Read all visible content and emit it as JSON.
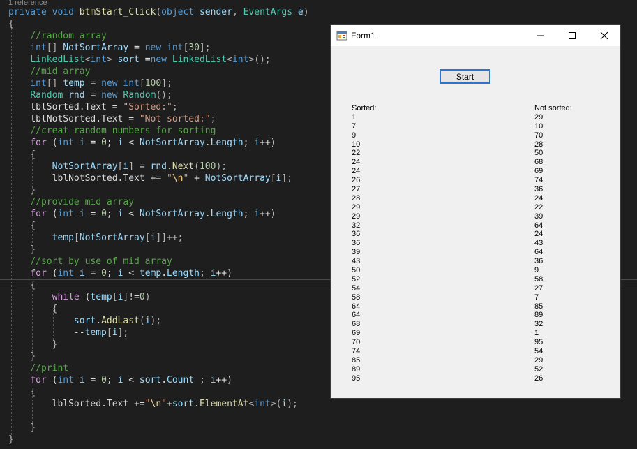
{
  "editor": {
    "codelens": "1 reference",
    "lines": [
      [
        [
          "kw",
          "private"
        ],
        [
          "t",
          " "
        ],
        [
          "kw",
          "void"
        ],
        [
          "t",
          " "
        ],
        [
          "fn",
          "btmStart_Click"
        ],
        [
          "pun",
          "("
        ],
        [
          "kw",
          "object"
        ],
        [
          "t",
          " "
        ],
        [
          "var",
          "sender"
        ],
        [
          "pun",
          ", "
        ],
        [
          "ty",
          "EventArgs"
        ],
        [
          "t",
          " "
        ],
        [
          "var",
          "e"
        ],
        [
          "pun",
          ")"
        ]
      ],
      [
        [
          "pun",
          "{"
        ]
      ],
      [
        [
          "t",
          "    "
        ],
        [
          "com",
          "//random array"
        ]
      ],
      [
        [
          "t",
          "    "
        ],
        [
          "kw",
          "int"
        ],
        [
          "pun",
          "[] "
        ],
        [
          "var",
          "NotSortArray"
        ],
        [
          "t",
          " = "
        ],
        [
          "kw",
          "new"
        ],
        [
          "t",
          " "
        ],
        [
          "kw",
          "int"
        ],
        [
          "pun",
          "["
        ],
        [
          "num",
          "30"
        ],
        [
          "pun",
          "];"
        ]
      ],
      [
        [
          "t",
          "    "
        ],
        [
          "ty",
          "LinkedList"
        ],
        [
          "pun",
          "<"
        ],
        [
          "kw",
          "int"
        ],
        [
          "pun",
          "> "
        ],
        [
          "var",
          "sort"
        ],
        [
          "t",
          " ="
        ],
        [
          "kw",
          "new"
        ],
        [
          "t",
          " "
        ],
        [
          "ty",
          "LinkedList"
        ],
        [
          "pun",
          "<"
        ],
        [
          "kw",
          "int"
        ],
        [
          "pun",
          ">();"
        ]
      ],
      [
        [
          "t",
          "    "
        ],
        [
          "com",
          "//mid array"
        ]
      ],
      [
        [
          "t",
          "    "
        ],
        [
          "kw",
          "int"
        ],
        [
          "pun",
          "[] "
        ],
        [
          "var",
          "temp"
        ],
        [
          "t",
          " = "
        ],
        [
          "kw",
          "new"
        ],
        [
          "t",
          " "
        ],
        [
          "kw",
          "int"
        ],
        [
          "pun",
          "["
        ],
        [
          "num",
          "100"
        ],
        [
          "pun",
          "];"
        ]
      ],
      [
        [
          "t",
          "    "
        ],
        [
          "ty",
          "Random"
        ],
        [
          "t",
          " "
        ],
        [
          "var",
          "rnd"
        ],
        [
          "t",
          " = "
        ],
        [
          "kw",
          "new"
        ],
        [
          "t",
          " "
        ],
        [
          "ty",
          "Random"
        ],
        [
          "pun",
          "();"
        ]
      ],
      [
        [
          "t",
          "    "
        ],
        [
          "t",
          "lblSorted.Text = "
        ],
        [
          "str",
          "\"Sorted:\""
        ],
        [
          "pun",
          ";"
        ]
      ],
      [
        [
          "t",
          "    "
        ],
        [
          "t",
          "lblNotSorted.Text = "
        ],
        [
          "str",
          "\"Not sorted:\""
        ],
        [
          "pun",
          ";"
        ]
      ],
      [
        [
          "t",
          "    "
        ],
        [
          "com",
          "//creat random numbers for sorting"
        ]
      ],
      [
        [
          "t",
          "    "
        ],
        [
          "ctl",
          "for"
        ],
        [
          "t",
          " ("
        ],
        [
          "kw",
          "int"
        ],
        [
          "t",
          " "
        ],
        [
          "var",
          "i"
        ],
        [
          "t",
          " = "
        ],
        [
          "num",
          "0"
        ],
        [
          "t",
          "; "
        ],
        [
          "var",
          "i"
        ],
        [
          "t",
          " < "
        ],
        [
          "var",
          "NotSortArray"
        ],
        [
          "t",
          "."
        ],
        [
          "var",
          "Length"
        ],
        [
          "t",
          "; "
        ],
        [
          "var",
          "i"
        ],
        [
          "t",
          "++)"
        ]
      ],
      [
        [
          "t",
          "    "
        ],
        [
          "pun",
          "{"
        ]
      ],
      [
        [
          "t",
          "        "
        ],
        [
          "var",
          "NotSortArray"
        ],
        [
          "pun",
          "["
        ],
        [
          "var",
          "i"
        ],
        [
          "pun",
          "]"
        ],
        [
          "t",
          " = "
        ],
        [
          "var",
          "rnd"
        ],
        [
          "t",
          "."
        ],
        [
          "fn",
          "Next"
        ],
        [
          "pun",
          "("
        ],
        [
          "num",
          "100"
        ],
        [
          "pun",
          ");"
        ]
      ],
      [
        [
          "t",
          "        "
        ],
        [
          "t",
          "lblNotSorted.Text += "
        ],
        [
          "str",
          "\""
        ],
        [
          "esc",
          "\\n"
        ],
        [
          "str",
          "\""
        ],
        [
          "t",
          " + "
        ],
        [
          "var",
          "NotSortArray"
        ],
        [
          "pun",
          "["
        ],
        [
          "var",
          "i"
        ],
        [
          "pun",
          "];"
        ]
      ],
      [
        [
          "t",
          "    "
        ],
        [
          "pun",
          "}"
        ]
      ],
      [
        [
          "t",
          "    "
        ],
        [
          "com",
          "//provide mid array"
        ]
      ],
      [
        [
          "t",
          "    "
        ],
        [
          "ctl",
          "for"
        ],
        [
          "t",
          " ("
        ],
        [
          "kw",
          "int"
        ],
        [
          "t",
          " "
        ],
        [
          "var",
          "i"
        ],
        [
          "t",
          " = "
        ],
        [
          "num",
          "0"
        ],
        [
          "t",
          "; "
        ],
        [
          "var",
          "i"
        ],
        [
          "t",
          " < "
        ],
        [
          "var",
          "NotSortArray"
        ],
        [
          "t",
          "."
        ],
        [
          "var",
          "Length"
        ],
        [
          "t",
          "; "
        ],
        [
          "var",
          "i"
        ],
        [
          "t",
          "++)"
        ]
      ],
      [
        [
          "t",
          "    "
        ],
        [
          "pun",
          "{"
        ]
      ],
      [
        [
          "t",
          "        "
        ],
        [
          "var",
          "temp"
        ],
        [
          "pun",
          "["
        ],
        [
          "var",
          "NotSortArray"
        ],
        [
          "pun",
          "["
        ],
        [
          "var",
          "i"
        ],
        [
          "pun",
          "]]++;"
        ]
      ],
      [
        [
          "t",
          "    "
        ],
        [
          "pun",
          "}"
        ]
      ],
      [
        [
          "t",
          "    "
        ],
        [
          "com",
          "//sort by use of mid array"
        ]
      ],
      [
        [
          "t",
          "    "
        ],
        [
          "ctl",
          "for"
        ],
        [
          "t",
          " ("
        ],
        [
          "kw",
          "int"
        ],
        [
          "t",
          " "
        ],
        [
          "var",
          "i"
        ],
        [
          "t",
          " = "
        ],
        [
          "num",
          "0"
        ],
        [
          "t",
          "; "
        ],
        [
          "var",
          "i"
        ],
        [
          "t",
          " < "
        ],
        [
          "var",
          "temp"
        ],
        [
          "t",
          "."
        ],
        [
          "var",
          "Length"
        ],
        [
          "t",
          "; "
        ],
        [
          "var",
          "i"
        ],
        [
          "t",
          "++)"
        ]
      ],
      [
        [
          "t",
          "    "
        ],
        [
          "pun",
          "{"
        ]
      ],
      [
        [
          "t",
          "        "
        ],
        [
          "ctl",
          "while"
        ],
        [
          "t",
          " ("
        ],
        [
          "var",
          "temp"
        ],
        [
          "pun",
          "["
        ],
        [
          "var",
          "i"
        ],
        [
          "pun",
          "]"
        ],
        [
          "t",
          "!="
        ],
        [
          "num",
          "0"
        ],
        [
          "pun",
          ")"
        ]
      ],
      [
        [
          "t",
          "        "
        ],
        [
          "pun",
          "{"
        ]
      ],
      [
        [
          "t",
          "            "
        ],
        [
          "var",
          "sort"
        ],
        [
          "t",
          "."
        ],
        [
          "fn",
          "AddLast"
        ],
        [
          "pun",
          "("
        ],
        [
          "var",
          "i"
        ],
        [
          "pun",
          ");"
        ]
      ],
      [
        [
          "t",
          "            "
        ],
        [
          "t",
          "--"
        ],
        [
          "var",
          "temp"
        ],
        [
          "pun",
          "["
        ],
        [
          "var",
          "i"
        ],
        [
          "pun",
          "];"
        ]
      ],
      [
        [
          "t",
          "        "
        ],
        [
          "pun",
          "}"
        ]
      ],
      [
        [
          "t",
          "    "
        ],
        [
          "pun",
          "}"
        ]
      ],
      [
        [
          "t",
          "    "
        ],
        [
          "com",
          "//print"
        ]
      ],
      [
        [
          "t",
          "    "
        ],
        [
          "ctl",
          "for"
        ],
        [
          "t",
          " ("
        ],
        [
          "kw",
          "int"
        ],
        [
          "t",
          " "
        ],
        [
          "var",
          "i"
        ],
        [
          "t",
          " = "
        ],
        [
          "num",
          "0"
        ],
        [
          "t",
          "; "
        ],
        [
          "var",
          "i"
        ],
        [
          "t",
          " < "
        ],
        [
          "var",
          "sort"
        ],
        [
          "t",
          "."
        ],
        [
          "var",
          "Count"
        ],
        [
          "t",
          " ; "
        ],
        [
          "var",
          "i"
        ],
        [
          "t",
          "++)"
        ]
      ],
      [
        [
          "t",
          "    "
        ],
        [
          "pun",
          "{"
        ]
      ],
      [
        [
          "t",
          "        "
        ],
        [
          "t",
          "lblSorted.Text +="
        ],
        [
          "str",
          "\""
        ],
        [
          "esc",
          "\\n"
        ],
        [
          "str",
          "\""
        ],
        [
          "t",
          "+"
        ],
        [
          "var",
          "sort"
        ],
        [
          "t",
          "."
        ],
        [
          "fn",
          "ElementAt"
        ],
        [
          "pun",
          "<"
        ],
        [
          "kw",
          "int"
        ],
        [
          "pun",
          ">("
        ],
        [
          "var",
          "i"
        ],
        [
          "pun",
          ");"
        ]
      ],
      [
        [
          "t",
          " "
        ]
      ],
      [
        [
          "t",
          "    "
        ],
        [
          "pun",
          "}"
        ]
      ],
      [
        [
          "pun",
          "}"
        ]
      ]
    ]
  },
  "form": {
    "title": "Form1",
    "start_button": "Start",
    "sorted_label": "Sorted:",
    "not_sorted_label": "Not sorted:",
    "sorted_values": [
      "1",
      "7",
      "9",
      "10",
      "22",
      "24",
      "24",
      "26",
      "27",
      "28",
      "29",
      "29",
      "32",
      "36",
      "36",
      "39",
      "43",
      "50",
      "52",
      "54",
      "58",
      "64",
      "64",
      "68",
      "69",
      "70",
      "74",
      "85",
      "89",
      "95"
    ],
    "not_sorted_values": [
      "29",
      "10",
      "70",
      "28",
      "50",
      "68",
      "69",
      "74",
      "36",
      "24",
      "22",
      "39",
      "64",
      "24",
      "43",
      "64",
      "36",
      "9",
      "58",
      "27",
      "7",
      "85",
      "89",
      "32",
      "1",
      "95",
      "54",
      "29",
      "52",
      "26"
    ]
  },
  "colors": {
    "editor_bg": "#1e1e1e",
    "keyword": "#569cd6",
    "type": "#4ec9b0",
    "comment": "#57a64a",
    "string": "#d69d85",
    "button_border": "#2a74d4"
  }
}
